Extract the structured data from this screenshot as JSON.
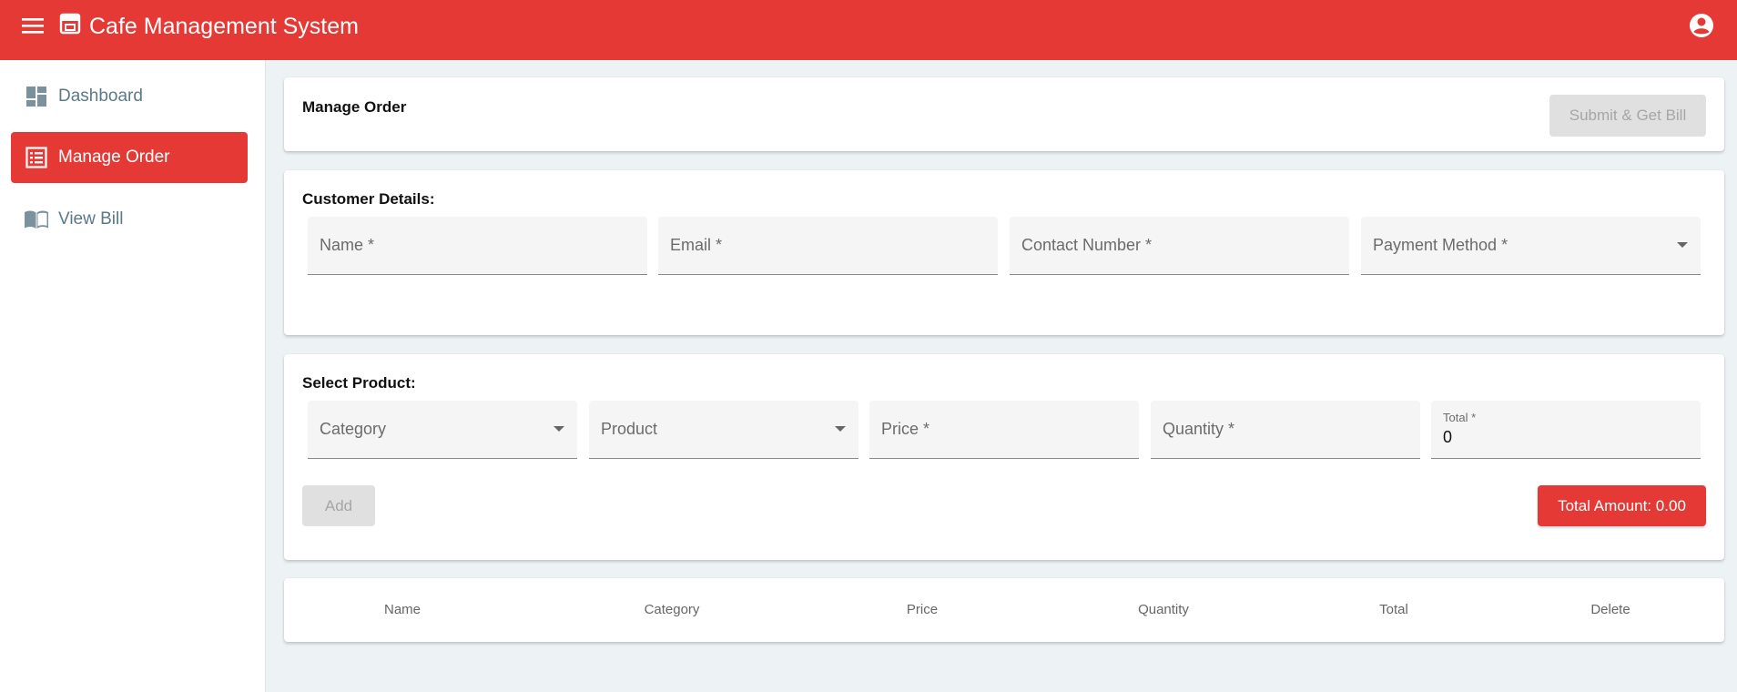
{
  "app": {
    "title": "Cafe Management System",
    "accent_color": "#e53935",
    "icons": {
      "menu": "menu-icon",
      "store": "store-icon",
      "account": "account-circle-icon"
    }
  },
  "sidebar": {
    "items": [
      {
        "label": "Dashboard",
        "icon": "dashboard-icon",
        "active": false
      },
      {
        "label": "Manage Order",
        "icon": "list-icon",
        "active": true
      },
      {
        "label": "View Bill",
        "icon": "book-icon",
        "active": false
      }
    ]
  },
  "header_card": {
    "title": "Manage Order",
    "submit_label": "Submit & Get Bill"
  },
  "customer": {
    "title": "Customer Details:",
    "name_placeholder": "Name *",
    "email_placeholder": "Email *",
    "contact_placeholder": "Contact Number *",
    "payment_placeholder": "Payment Method *"
  },
  "product": {
    "title": "Select Product:",
    "category_placeholder": "Category",
    "product_placeholder": "Product",
    "price_placeholder": "Price *",
    "quantity_placeholder": "Quantity *",
    "total_label": "Total *",
    "total_value": "0",
    "add_label": "Add",
    "total_amount_label": "Total Amount: 0.00"
  },
  "table": {
    "columns": [
      "Name",
      "Category",
      "Price",
      "Quantity",
      "Total",
      "Delete"
    ],
    "rows": []
  }
}
